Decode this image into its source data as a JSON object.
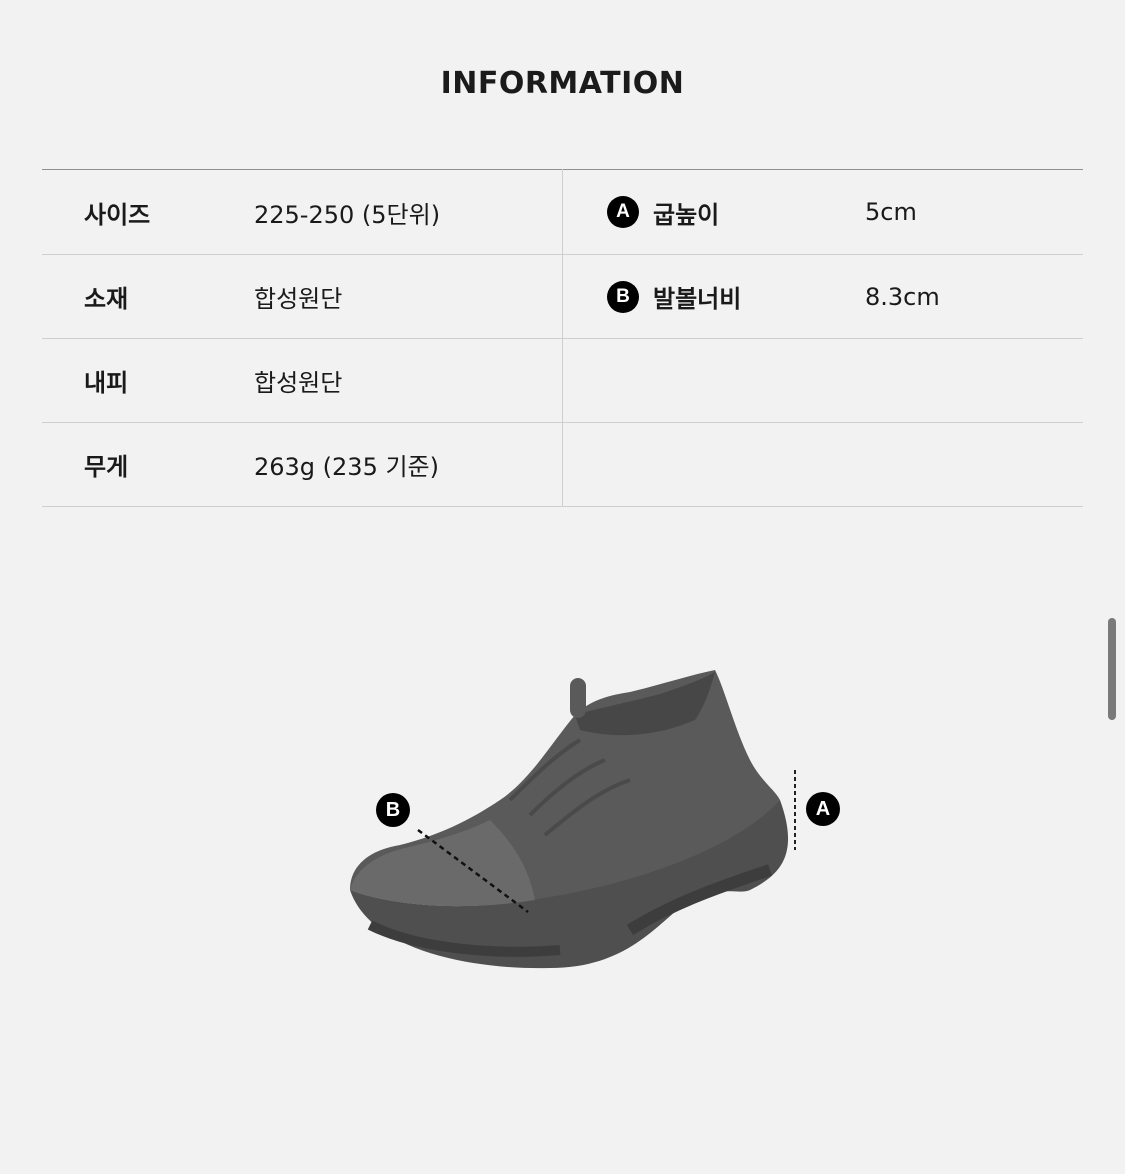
{
  "title": "INFORMATION",
  "table": {
    "rows": [
      {
        "label": "사이즈",
        "value": "225-250 (5단위)"
      },
      {
        "label": "소재",
        "value": "합성원단"
      },
      {
        "label": "내피",
        "value": "합성원단"
      },
      {
        "label": "무게",
        "value": "263g (235 기준)"
      }
    ],
    "measures": [
      {
        "badge": "A",
        "label": "굽높이",
        "value": "5cm"
      },
      {
        "badge": "B",
        "label": "발볼너비",
        "value": "8.3cm"
      }
    ]
  },
  "diagram": {
    "marker_a": "A",
    "marker_b": "B",
    "image": "sneaker-illustration"
  },
  "colors": {
    "background": "#f2f2f2",
    "text": "#1a1a1a",
    "badge": "#000000",
    "shoe": "#5a5a5a"
  }
}
